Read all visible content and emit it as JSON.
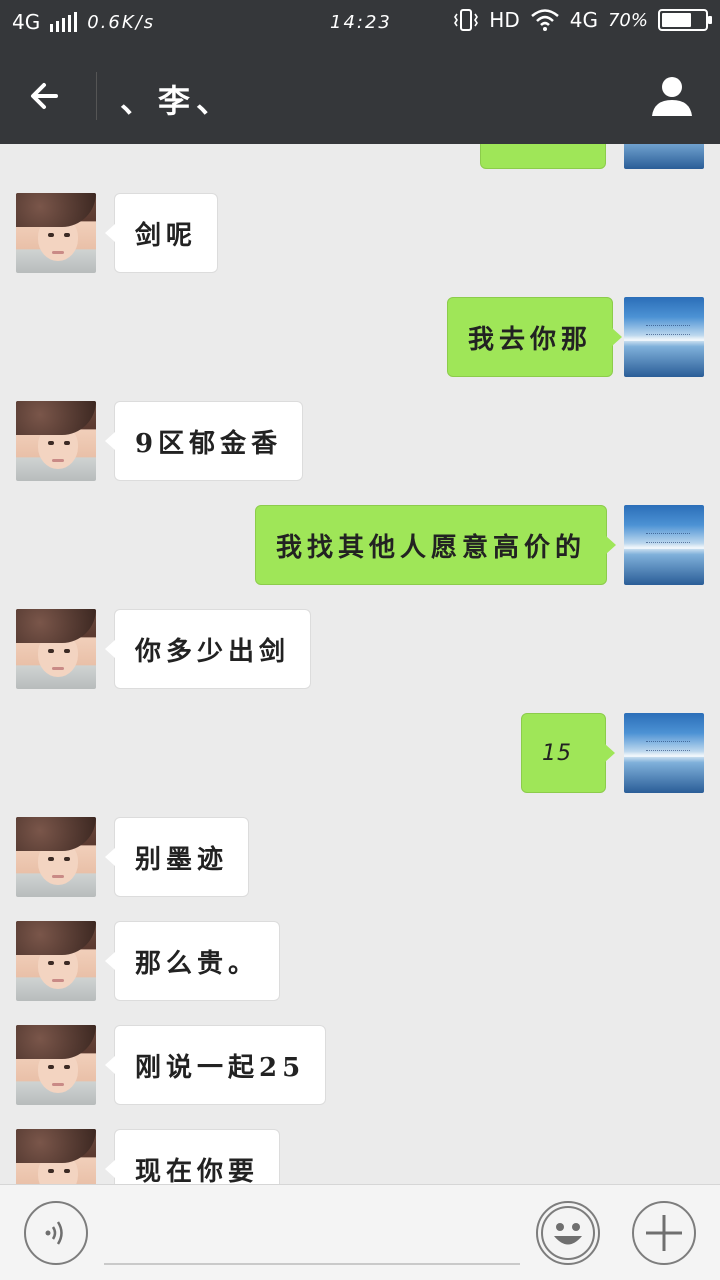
{
  "status_bar": {
    "network": "4G",
    "net_speed": "0.6K/s",
    "time": "14:23",
    "hd_label": "HD",
    "network_right": "4G",
    "battery_percent": "70%",
    "battery_level": 0.7
  },
  "header": {
    "title": "、李、"
  },
  "messages": [
    {
      "side": "out",
      "text": ""
    },
    {
      "side": "in",
      "text": "剑呢"
    },
    {
      "side": "out",
      "text": "我去你那"
    },
    {
      "side": "in",
      "text": "9区郁金香"
    },
    {
      "side": "out",
      "text": "我找其他人愿意高价的"
    },
    {
      "side": "in",
      "text": "你多少出剑"
    },
    {
      "side": "out",
      "text": "15"
    },
    {
      "side": "in",
      "text": "别墨迹"
    },
    {
      "side": "in",
      "text": "那么贵。"
    },
    {
      "side": "in",
      "text": "刚说一起25"
    },
    {
      "side": "in",
      "text": "现在你要"
    }
  ],
  "icons": {
    "back": "arrow-left-icon",
    "profile": "person-icon",
    "voice": "voice-icon",
    "emoji": "emoji-icon",
    "plus": "plus-icon"
  },
  "colors": {
    "header_bg": "#35373a",
    "chat_bg": "#ebebeb",
    "outgoing_bubble": "#9fe658",
    "incoming_bubble": "#ffffff"
  }
}
